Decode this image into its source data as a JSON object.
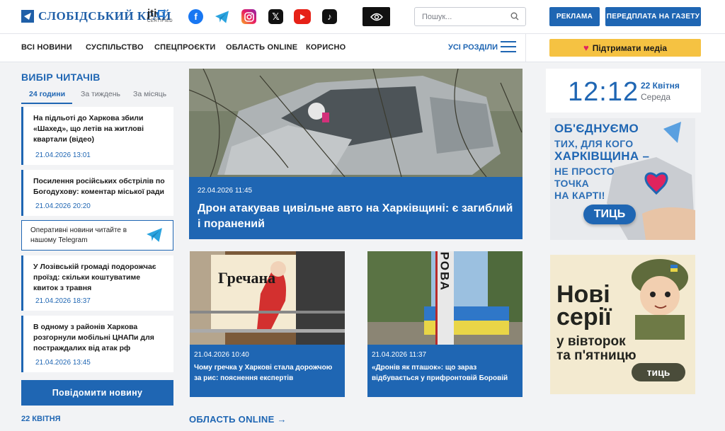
{
  "header": {
    "logo_text": "СЛОБІДСЬКИЙ КРАЙ",
    "jti_text": "jti",
    "jti_sub": "CERTIFIED",
    "search_placeholder": "Пошук...",
    "ads_label": "РЕКЛАМА",
    "subscribe_label": "ПЕРЕДПЛАТА НА ГАЗЕТУ",
    "social": [
      "facebook-icon",
      "telegram-icon",
      "instagram-icon",
      "x-icon",
      "youtube-icon",
      "tiktok-icon"
    ]
  },
  "nav": {
    "items": [
      "ВСІ НОВИНИ",
      "СУСПІЛЬСТВО",
      "СПЕЦПРОЄКТИ",
      "ОБЛАСТЬ ONLINE",
      "КОРИСНО"
    ],
    "all_sections": "УСІ РОЗДІЛИ",
    "support": "Підтримати медіа"
  },
  "readers_choice": {
    "title": "ВИБІР ЧИТАЧІВ",
    "tabs": [
      "24 години",
      "За тиждень",
      "За місяць"
    ],
    "items": [
      {
        "title": "На підльоті до Харкова збили «Шахед», що летів на житлові квартали (відео)",
        "date": "21.04.2026   13:01"
      },
      {
        "title": "Посилення російських обстрілів по Богодухову: коментар міської ради",
        "date": "21.04.2026   20:20"
      },
      {
        "title": "У Лозівській громаді подорожчає проїзд: скільки коштуватиме квиток з травня",
        "date": "21.04.2026   18:37"
      },
      {
        "title": "В одному з районів Харкова розгорнули мобільні ЦНАПи для постраждалих від атак рф",
        "date": "21.04.2026   13:45"
      }
    ],
    "telegram_text": "Оперативні новини читайте в нашому Telegram",
    "report_button": "Повідомити новину",
    "date_heading": "22 КВІТНЯ"
  },
  "main_story": {
    "date": "22.04.2026   11:45",
    "title": "Дрон атакував цивільне авто на Харківщині: є загиблий і поранений"
  },
  "stories": [
    {
      "date": "21.04.2026   10:40",
      "title": "Чому гречка у Харкові стала дорожчою за рис: пояснення експертів",
      "img_text": "Гречана"
    },
    {
      "date": "21.04.2026   11:37",
      "title": "«Дронів як пташок»: що зараз відбувається у прифронтовій Боровій",
      "img_text": "БОРОВА"
    }
  ],
  "oblast_link": "ОБЛАСТЬ ONLINE →",
  "clock": {
    "time": "12:12",
    "date": "22 Квітня",
    "day": "Середа"
  },
  "ad1": {
    "lines": [
      "ОБ'ЄДНУЄМО",
      "ТИХ, ДЛЯ КОГО",
      "ХАРКІВЩИНА –",
      "НЕ ПРОСТО",
      "ТОЧКА",
      "НА КАРТІ!"
    ],
    "button": "ТИЦЬ"
  },
  "ad2": {
    "big1": "Нові",
    "big2": "серії",
    "mid1": "у вівторок",
    "mid2": "та п'ятницю",
    "button": "тиць"
  },
  "colors": {
    "primary": "#1f66b3",
    "accent_yellow": "#f5c242",
    "heart": "#e0245e"
  }
}
